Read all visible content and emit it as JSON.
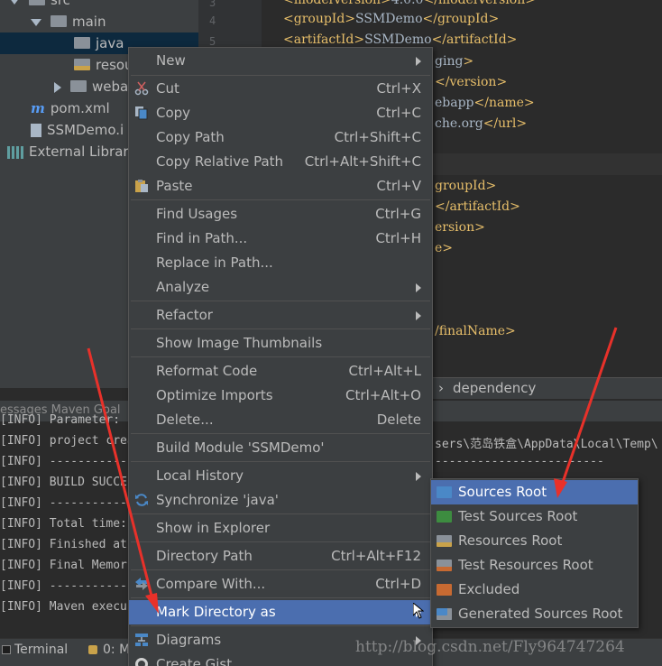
{
  "project_tree": {
    "items": [
      {
        "label": "src",
        "icon": "folder-icon",
        "expanded": true
      },
      {
        "label": "main",
        "icon": "folder-icon",
        "expanded": true
      },
      {
        "label": "java",
        "icon": "folder-icon",
        "selected": true
      },
      {
        "label": "resou",
        "icon": "resources-folder-icon"
      },
      {
        "label": "weba",
        "icon": "folder-icon",
        "expanded": false
      },
      {
        "label": "pom.xml",
        "icon": "maven-icon"
      },
      {
        "label": "SSMDemo.i",
        "icon": "module-file-icon"
      },
      {
        "label": "External Librari",
        "icon": "library-icon"
      }
    ]
  },
  "editor": {
    "line_numbers": [
      "3",
      "4",
      "5"
    ],
    "lines": [
      {
        "tag1": "<modelVersion>",
        "text": "4.0.0",
        "tag2": "</modelVersion>"
      },
      {
        "tag1": "<groupId>",
        "text": "SSMDemo",
        "tag2": "</groupId>"
      },
      {
        "tag1": "<artifactId>",
        "text": "SSMDemo",
        "tag2": "</artifactId>"
      },
      {
        "tag1": "",
        "text": "ging",
        "tag2": ">"
      },
      {
        "tag1": "",
        "text": "",
        "tag2": "</version>"
      },
      {
        "tag1": "",
        "text": "ebapp",
        "tag2": "</name>"
      },
      {
        "tag1": "",
        "text": "che.org",
        "tag2": "</url>"
      },
      {
        "tag1": "",
        "text": "",
        "tag2": "groupId>"
      },
      {
        "tag1": "",
        "text": "",
        "tag2": "</artifactId>"
      },
      {
        "tag1": "",
        "text": "",
        "tag2": "ersion>"
      },
      {
        "tag1": "",
        "text": "",
        "tag2": "e>"
      },
      {
        "tag1": "",
        "text": "",
        "tag2": "/finalName>"
      }
    ],
    "breadcrumb": {
      "chevron": "›",
      "item": "dependency"
    }
  },
  "bottom_panel": {
    "tabs_label": "essages Maven Goal",
    "console_lines": [
      "[INFO] Parameter:",
      "[INFO] project crea",
      "[INFO] -----------",
      "[INFO] BUILD SUCCE",
      "[INFO] -----------",
      "[INFO] Total time:",
      "[INFO] Finished at",
      "[INFO] Final Memor",
      "[INFO] -----------",
      "[INFO] Maven execu"
    ],
    "console_right": "sers\\范岛铁盒\\AppData\\Local\\Temp\\",
    "console_right_dashes": "------------------------",
    "status_tabs": {
      "terminal": "Terminal",
      "messages": "0: M"
    }
  },
  "context_menu": {
    "items": [
      {
        "label": "New",
        "shortcut": "",
        "submenu": true,
        "icon": ""
      },
      {
        "label": "Cut",
        "shortcut": "Ctrl+X",
        "icon": "scissors-icon"
      },
      {
        "label": "Copy",
        "shortcut": "Ctrl+C",
        "icon": "copy-icon"
      },
      {
        "label": "Copy Path",
        "shortcut": "Ctrl+Shift+C"
      },
      {
        "label": "Copy Relative Path",
        "shortcut": "Ctrl+Alt+Shift+C"
      },
      {
        "label": "Paste",
        "shortcut": "Ctrl+V",
        "icon": "paste-icon"
      },
      {
        "label": "Find Usages",
        "shortcut": "Ctrl+G"
      },
      {
        "label": "Find in Path...",
        "shortcut": "Ctrl+H"
      },
      {
        "label": "Replace in Path...",
        "shortcut": ""
      },
      {
        "label": "Analyze",
        "shortcut": "",
        "submenu": true
      },
      {
        "label": "Refactor",
        "shortcut": "",
        "submenu": true
      },
      {
        "label": "Show Image Thumbnails",
        "shortcut": ""
      },
      {
        "label": "Reformat Code",
        "shortcut": "Ctrl+Alt+L"
      },
      {
        "label": "Optimize Imports",
        "shortcut": "Ctrl+Alt+O"
      },
      {
        "label": "Delete...",
        "shortcut": "Delete"
      },
      {
        "label": "Build Module 'SSMDemo'",
        "shortcut": ""
      },
      {
        "label": "Local History",
        "shortcut": "",
        "submenu": true
      },
      {
        "label": "Synchronize 'java'",
        "shortcut": "",
        "icon": "sync-icon"
      },
      {
        "label": "Show in Explorer",
        "shortcut": ""
      },
      {
        "label": "Directory Path",
        "shortcut": "Ctrl+Alt+F12"
      },
      {
        "label": "Compare With...",
        "shortcut": "Ctrl+D",
        "icon": "compare-icon"
      },
      {
        "label": "Mark Directory as",
        "shortcut": "",
        "submenu": true,
        "highlighted": true
      },
      {
        "label": "Diagrams",
        "shortcut": "",
        "submenu": true,
        "icon": "diagram-icon"
      },
      {
        "label": "Create Gist...",
        "shortcut": "",
        "icon": "github-icon"
      }
    ]
  },
  "submenu": {
    "items": [
      {
        "label": "Sources Root",
        "color": "#4a88c7",
        "highlighted": true
      },
      {
        "label": "Test Sources Root",
        "color": "#3d8c40"
      },
      {
        "label": "Resources Root",
        "color": "#8a9199"
      },
      {
        "label": "Test Resources Root",
        "color": "#8a9199"
      },
      {
        "label": "Excluded",
        "color": "#c76a32"
      },
      {
        "label": "Generated Sources Root",
        "color": "#4a88c7"
      }
    ]
  },
  "colors": {
    "highlight": "#4b6eaf",
    "arrow": "#e8312a",
    "menu_bg": "#3c3f41"
  },
  "watermark": "http://blog.csdn.net/Fly964747264"
}
